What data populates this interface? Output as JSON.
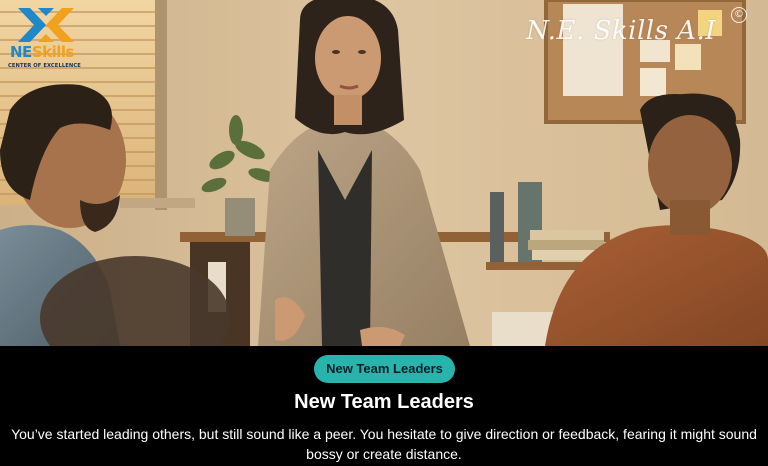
{
  "logo": {
    "word_ne": "NE",
    "word_skills": "Skills",
    "tagline": "CENTER OF EXCELLENCE"
  },
  "watermark": {
    "text": "N.E. Skills A.I",
    "copyright_symbol": "©"
  },
  "scene": {
    "description_icon": "photo-scene"
  },
  "badge": {
    "label": "New Team Leaders"
  },
  "title": "New Team Leaders",
  "description": "You’ve started leading others, but still sound like a peer. You hesitate to give direction or feedback, fearing it might sound bossy or create distance.",
  "colors": {
    "badge": "#29b3ad",
    "panel_background": "#000000",
    "logo_blue": "#1e88c9",
    "logo_orange": "#f0a21c"
  }
}
